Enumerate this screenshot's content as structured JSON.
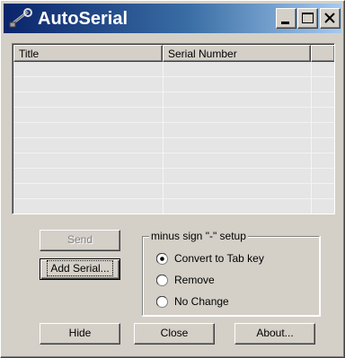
{
  "window": {
    "title": "AutoSerial",
    "app_icon": "key-icon",
    "controls": {
      "minimize": "minimize-icon",
      "maximize": "maximize-icon",
      "close": "close-icon"
    }
  },
  "list": {
    "columns": [
      "Title",
      "Serial Number"
    ],
    "rows": []
  },
  "buttons": {
    "send": "Send",
    "add_serial": "Add Serial...",
    "hide": "Hide",
    "close": "Close",
    "about": "About..."
  },
  "minus_setup": {
    "label": "minus sign \"-\" setup",
    "options": [
      "Convert to Tab key",
      "Remove",
      "No Change"
    ],
    "selected": "Convert to Tab key"
  },
  "colors": {
    "title_start": "#0a246a",
    "title_end": "#a6caf0",
    "face": "#d4d0c8"
  }
}
